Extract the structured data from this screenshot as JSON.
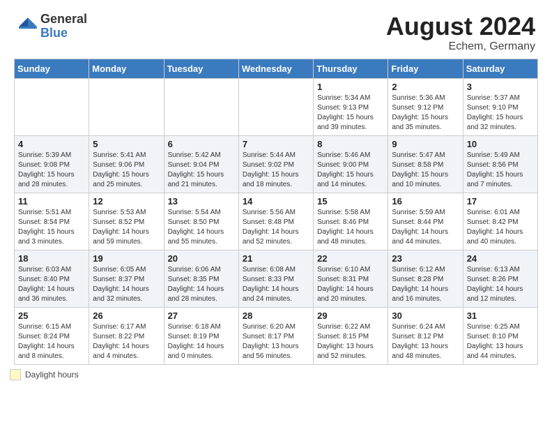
{
  "header": {
    "logo_general": "General",
    "logo_blue": "Blue",
    "month_year": "August 2024",
    "location": "Echem, Germany"
  },
  "calendar": {
    "days_of_week": [
      "Sunday",
      "Monday",
      "Tuesday",
      "Wednesday",
      "Thursday",
      "Friday",
      "Saturday"
    ],
    "weeks": [
      [
        {
          "day": "",
          "info": ""
        },
        {
          "day": "",
          "info": ""
        },
        {
          "day": "",
          "info": ""
        },
        {
          "day": "",
          "info": ""
        },
        {
          "day": "1",
          "info": "Sunrise: 5:34 AM\nSunset: 9:13 PM\nDaylight: 15 hours and 39 minutes."
        },
        {
          "day": "2",
          "info": "Sunrise: 5:36 AM\nSunset: 9:12 PM\nDaylight: 15 hours and 35 minutes."
        },
        {
          "day": "3",
          "info": "Sunrise: 5:37 AM\nSunset: 9:10 PM\nDaylight: 15 hours and 32 minutes."
        }
      ],
      [
        {
          "day": "4",
          "info": "Sunrise: 5:39 AM\nSunset: 9:08 PM\nDaylight: 15 hours and 28 minutes."
        },
        {
          "day": "5",
          "info": "Sunrise: 5:41 AM\nSunset: 9:06 PM\nDaylight: 15 hours and 25 minutes."
        },
        {
          "day": "6",
          "info": "Sunrise: 5:42 AM\nSunset: 9:04 PM\nDaylight: 15 hours and 21 minutes."
        },
        {
          "day": "7",
          "info": "Sunrise: 5:44 AM\nSunset: 9:02 PM\nDaylight: 15 hours and 18 minutes."
        },
        {
          "day": "8",
          "info": "Sunrise: 5:46 AM\nSunset: 9:00 PM\nDaylight: 15 hours and 14 minutes."
        },
        {
          "day": "9",
          "info": "Sunrise: 5:47 AM\nSunset: 8:58 PM\nDaylight: 15 hours and 10 minutes."
        },
        {
          "day": "10",
          "info": "Sunrise: 5:49 AM\nSunset: 8:56 PM\nDaylight: 15 hours and 7 minutes."
        }
      ],
      [
        {
          "day": "11",
          "info": "Sunrise: 5:51 AM\nSunset: 8:54 PM\nDaylight: 15 hours and 3 minutes."
        },
        {
          "day": "12",
          "info": "Sunrise: 5:53 AM\nSunset: 8:52 PM\nDaylight: 14 hours and 59 minutes."
        },
        {
          "day": "13",
          "info": "Sunrise: 5:54 AM\nSunset: 8:50 PM\nDaylight: 14 hours and 55 minutes."
        },
        {
          "day": "14",
          "info": "Sunrise: 5:56 AM\nSunset: 8:48 PM\nDaylight: 14 hours and 52 minutes."
        },
        {
          "day": "15",
          "info": "Sunrise: 5:58 AM\nSunset: 8:46 PM\nDaylight: 14 hours and 48 minutes."
        },
        {
          "day": "16",
          "info": "Sunrise: 5:59 AM\nSunset: 8:44 PM\nDaylight: 14 hours and 44 minutes."
        },
        {
          "day": "17",
          "info": "Sunrise: 6:01 AM\nSunset: 8:42 PM\nDaylight: 14 hours and 40 minutes."
        }
      ],
      [
        {
          "day": "18",
          "info": "Sunrise: 6:03 AM\nSunset: 8:40 PM\nDaylight: 14 hours and 36 minutes."
        },
        {
          "day": "19",
          "info": "Sunrise: 6:05 AM\nSunset: 8:37 PM\nDaylight: 14 hours and 32 minutes."
        },
        {
          "day": "20",
          "info": "Sunrise: 6:06 AM\nSunset: 8:35 PM\nDaylight: 14 hours and 28 minutes."
        },
        {
          "day": "21",
          "info": "Sunrise: 6:08 AM\nSunset: 8:33 PM\nDaylight: 14 hours and 24 minutes."
        },
        {
          "day": "22",
          "info": "Sunrise: 6:10 AM\nSunset: 8:31 PM\nDaylight: 14 hours and 20 minutes."
        },
        {
          "day": "23",
          "info": "Sunrise: 6:12 AM\nSunset: 8:28 PM\nDaylight: 14 hours and 16 minutes."
        },
        {
          "day": "24",
          "info": "Sunrise: 6:13 AM\nSunset: 8:26 PM\nDaylight: 14 hours and 12 minutes."
        }
      ],
      [
        {
          "day": "25",
          "info": "Sunrise: 6:15 AM\nSunset: 8:24 PM\nDaylight: 14 hours and 8 minutes."
        },
        {
          "day": "26",
          "info": "Sunrise: 6:17 AM\nSunset: 8:22 PM\nDaylight: 14 hours and 4 minutes."
        },
        {
          "day": "27",
          "info": "Sunrise: 6:18 AM\nSunset: 8:19 PM\nDaylight: 14 hours and 0 minutes."
        },
        {
          "day": "28",
          "info": "Sunrise: 6:20 AM\nSunset: 8:17 PM\nDaylight: 13 hours and 56 minutes."
        },
        {
          "day": "29",
          "info": "Sunrise: 6:22 AM\nSunset: 8:15 PM\nDaylight: 13 hours and 52 minutes."
        },
        {
          "day": "30",
          "info": "Sunrise: 6:24 AM\nSunset: 8:12 PM\nDaylight: 13 hours and 48 minutes."
        },
        {
          "day": "31",
          "info": "Sunrise: 6:25 AM\nSunset: 8:10 PM\nDaylight: 13 hours and 44 minutes."
        }
      ]
    ]
  },
  "legend": {
    "label": "Daylight hours"
  }
}
